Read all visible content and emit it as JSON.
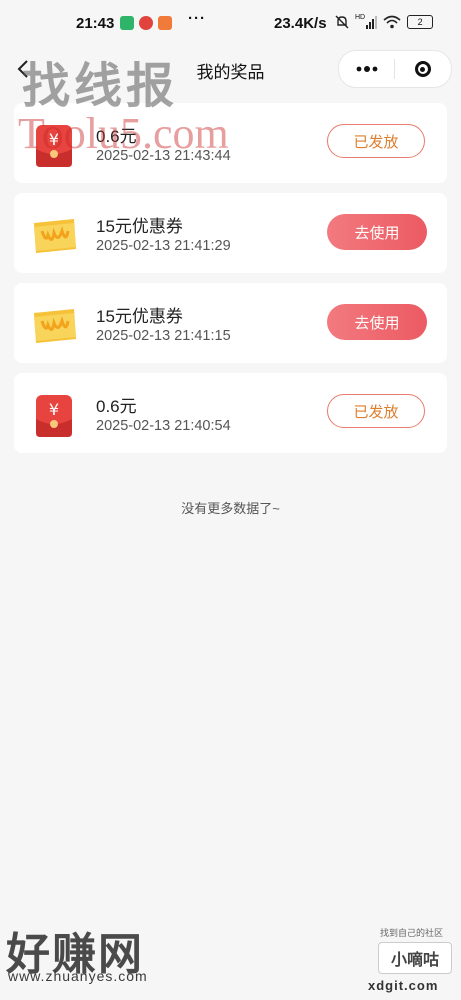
{
  "status_bar": {
    "time": "21:43",
    "dots": "···",
    "net_speed": "23.4K/s",
    "signal_label": "HD",
    "battery": "2"
  },
  "header": {
    "back_glyph": "‹",
    "title": "我的奖品"
  },
  "prizes": [
    {
      "icon": "red-envelope-icon",
      "name": "0.6元",
      "time": "2025-02-13 21:43:44",
      "action": "已发放",
      "action_type": "issued"
    },
    {
      "icon": "coupon-icon",
      "name": "15元优惠券",
      "time": "2025-02-13 21:41:29",
      "action": "去使用",
      "action_type": "use"
    },
    {
      "icon": "coupon-icon",
      "name": "15元优惠券",
      "time": "2025-02-13 21:41:15",
      "action": "去使用",
      "action_type": "use"
    },
    {
      "icon": "red-envelope-icon",
      "name": "0.6元",
      "time": "2025-02-13 21:40:54",
      "action": "已发放",
      "action_type": "issued"
    }
  ],
  "footer_text": "没有更多数据了~",
  "watermarks": {
    "top": "找线报",
    "tools": "Toolu5.com",
    "zhuan": "好赚网",
    "zhuan_url": "www.zhuanyes.com",
    "xd_top": "找到自己的社区",
    "xd_box": "小嘀咕",
    "xd_url": "xdgit.com"
  },
  "colors": {
    "accent_red": "#ec5a62",
    "issued_text": "#de7f2e",
    "background": "#f6f6f6"
  }
}
